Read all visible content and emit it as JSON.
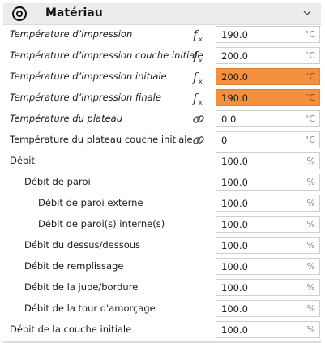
{
  "section": {
    "title": "Matériau",
    "icon": "spool-icon",
    "collapse_icon": "chevron-down-icon"
  },
  "colors": {
    "highlight": "#f5913e",
    "header_bg": "#ececec"
  },
  "rows": [
    {
      "label": "Température d’impression",
      "italic": true,
      "indent": 0,
      "icon": "function-icon",
      "value": "190.0",
      "unit": "°C",
      "highlight": false
    },
    {
      "label": "Température d’impression couche initiale",
      "italic": true,
      "indent": 0,
      "icon": "function-icon",
      "value": "200.0",
      "unit": "°C",
      "highlight": false
    },
    {
      "label": "Température d’impression initiale",
      "italic": true,
      "indent": 0,
      "icon": "function-icon",
      "value": "200.0",
      "unit": "°C",
      "highlight": true
    },
    {
      "label": "Température d’impression finale",
      "italic": true,
      "indent": 0,
      "icon": "function-icon",
      "value": "190.0",
      "unit": "°C",
      "highlight": true
    },
    {
      "label": "Température du plateau",
      "italic": true,
      "indent": 0,
      "icon": "link-icon",
      "value": "0.0",
      "unit": "°C",
      "highlight": false
    },
    {
      "label": "Température du plateau couche initiale",
      "italic": false,
      "indent": 0,
      "icon": "link-icon",
      "value": "0",
      "unit": "°C",
      "highlight": false
    },
    {
      "label": "Débit",
      "italic": false,
      "indent": 0,
      "icon": "",
      "value": "100.0",
      "unit": "%",
      "highlight": false
    },
    {
      "label": "Débit de paroi",
      "italic": false,
      "indent": 1,
      "icon": "",
      "value": "100.0",
      "unit": "%",
      "highlight": false
    },
    {
      "label": "Débit de paroi externe",
      "italic": false,
      "indent": 2,
      "icon": "",
      "value": "100.0",
      "unit": "%",
      "highlight": false
    },
    {
      "label": "Débit de paroi(s) interne(s)",
      "italic": false,
      "indent": 2,
      "icon": "",
      "value": "100.0",
      "unit": "%",
      "highlight": false
    },
    {
      "label": "Débit du dessus/dessous",
      "italic": false,
      "indent": 1,
      "icon": "",
      "value": "100.0",
      "unit": "%",
      "highlight": false
    },
    {
      "label": "Débit de remplissage",
      "italic": false,
      "indent": 1,
      "icon": "",
      "value": "100.0",
      "unit": "%",
      "highlight": false
    },
    {
      "label": "Débit de la jupe/bordure",
      "italic": false,
      "indent": 1,
      "icon": "",
      "value": "100.0",
      "unit": "%",
      "highlight": false
    },
    {
      "label": "Débit de la tour d'amorçage",
      "italic": false,
      "indent": 1,
      "icon": "",
      "value": "100.0",
      "unit": "%",
      "highlight": false
    },
    {
      "label": "Débit de la couche initiale",
      "italic": false,
      "indent": 0,
      "icon": "",
      "value": "100.0",
      "unit": "%",
      "highlight": false
    }
  ]
}
